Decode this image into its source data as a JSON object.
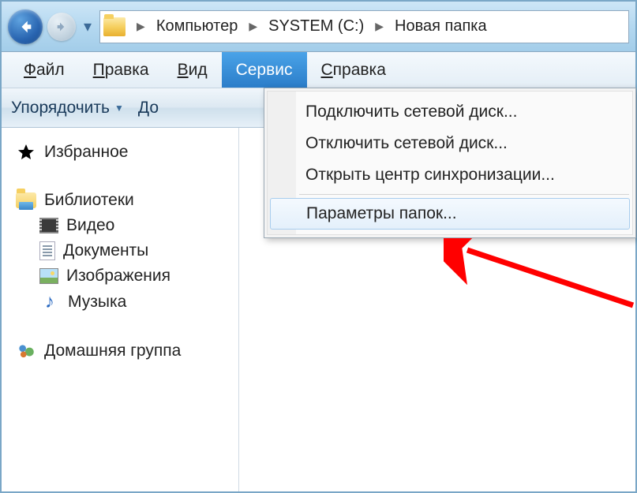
{
  "breadcrumb": {
    "items": [
      "Компьютер",
      "SYSTEM (C:)",
      "Новая папка"
    ]
  },
  "menubar": {
    "file": "Файл",
    "edit": "Правка",
    "view": "Вид",
    "tools": "Сервис",
    "help": "Справка"
  },
  "toolbar": {
    "organize": "Упорядочить",
    "add_truncated": "До"
  },
  "sidebar": {
    "favorites": "Избранное",
    "libraries": "Библиотеки",
    "children": {
      "video": "Видео",
      "documents": "Документы",
      "images": "Изображения",
      "music": "Музыка"
    },
    "homegroup": "Домашняя группа"
  },
  "dropdown": {
    "map_drive": "Подключить сетевой диск...",
    "disconnect_drive": "Отключить сетевой диск...",
    "sync_center": "Открыть центр синхронизации...",
    "folder_options": "Параметры папок..."
  }
}
